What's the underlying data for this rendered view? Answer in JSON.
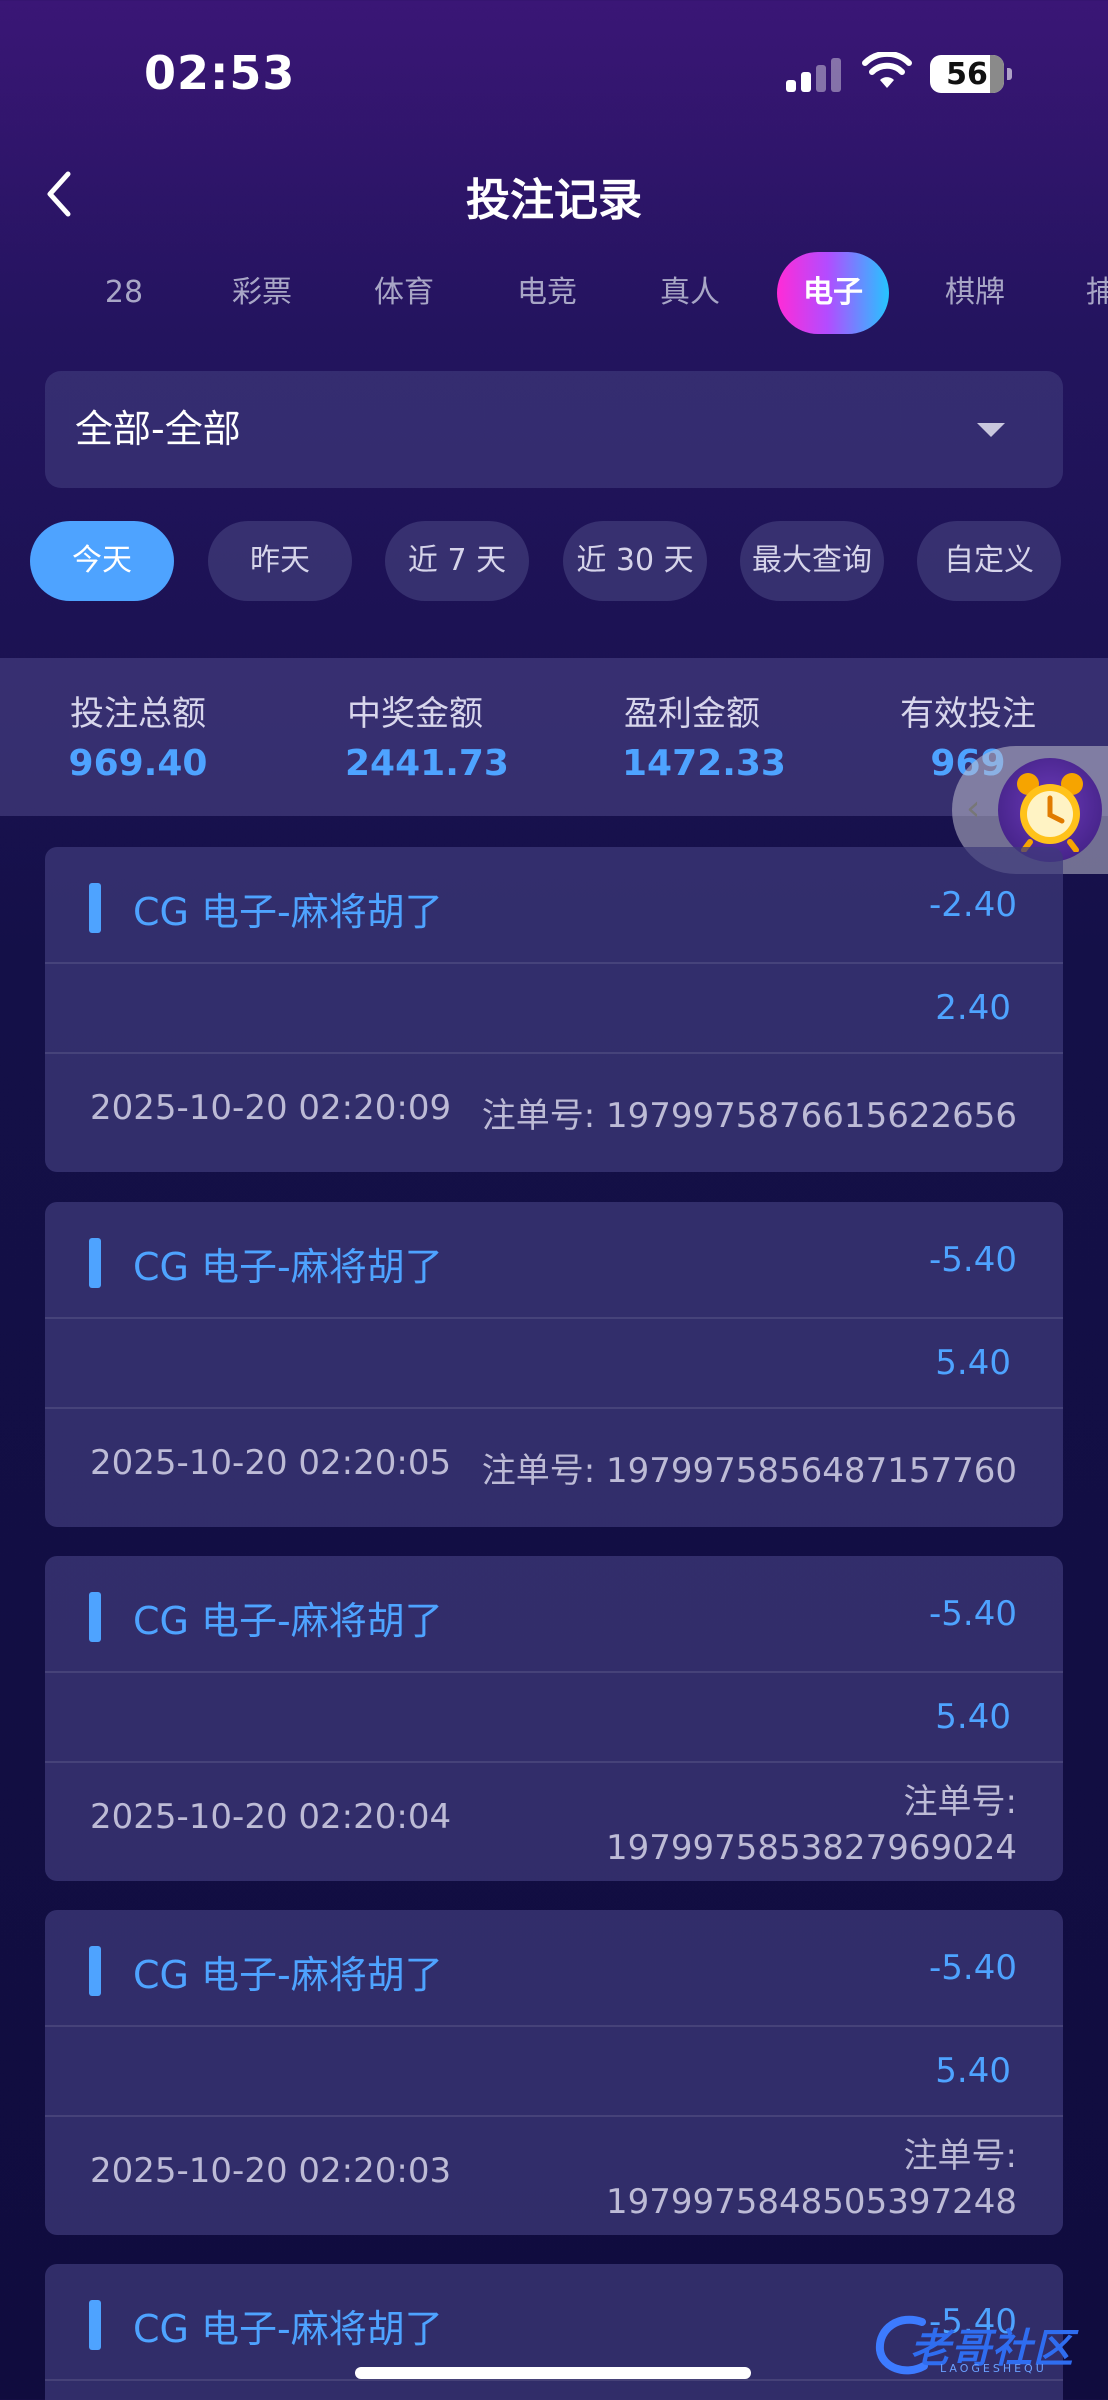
{
  "status_bar": {
    "time": "02:53",
    "battery": "56"
  },
  "header": {
    "title": "投注记录"
  },
  "tabs": [
    {
      "label": "28",
      "active": false
    },
    {
      "label": "彩票",
      "active": false
    },
    {
      "label": "体育",
      "active": false
    },
    {
      "label": "电竞",
      "active": false
    },
    {
      "label": "真人",
      "active": false
    },
    {
      "label": "电子",
      "active": true
    },
    {
      "label": "棋牌",
      "active": false
    },
    {
      "label": "捕",
      "active": false
    }
  ],
  "filter": {
    "selected": "全部-全部"
  },
  "date_ranges": [
    {
      "label": "今天",
      "active": true
    },
    {
      "label": "昨天",
      "active": false
    },
    {
      "label": "近 7 天",
      "active": false
    },
    {
      "label": "近 30 天",
      "active": false
    },
    {
      "label": "最大查询",
      "active": false
    },
    {
      "label": "自定义",
      "active": false
    }
  ],
  "summary": [
    {
      "label": "投注总额",
      "value": "969.40"
    },
    {
      "label": "中奖金额",
      "value": "2441.73"
    },
    {
      "label": "盈利金额",
      "value": "1472.33"
    },
    {
      "label": "有效投注",
      "value": "969"
    }
  ],
  "records": [
    {
      "game": "CG 电子-麻将胡了",
      "amount": "-2.40",
      "payout": "2.40",
      "datetime": "2025-10-20 02:20:09",
      "order_label": "注单号:",
      "order_no": "1979975876615622656"
    },
    {
      "game": "CG 电子-麻将胡了",
      "amount": "-5.40",
      "payout": "5.40",
      "datetime": "2025-10-20 02:20:05",
      "order_label": "注单号:",
      "order_no": "1979975856487157760"
    },
    {
      "game": "CG 电子-麻将胡了",
      "amount": "-5.40",
      "payout": "5.40",
      "datetime": "2025-10-20 02:20:04",
      "order_label": "注单号:",
      "order_no": "1979975853827969024"
    },
    {
      "game": "CG 电子-麻将胡了",
      "amount": "-5.40",
      "payout": "5.40",
      "datetime": "2025-10-20 02:20:03",
      "order_label": "注单号:",
      "order_no": "1979975848505397248"
    },
    {
      "game": "CG 电子-麻将胡了",
      "amount": "-5.40"
    }
  ],
  "watermark": {
    "text": "老哥社区",
    "sub": "LAOGESHEQU"
  },
  "colors": {
    "accent": "#4ea3ff",
    "tab_gradient_start": "#ff2bd7",
    "tab_gradient_end": "#25c5ff"
  }
}
